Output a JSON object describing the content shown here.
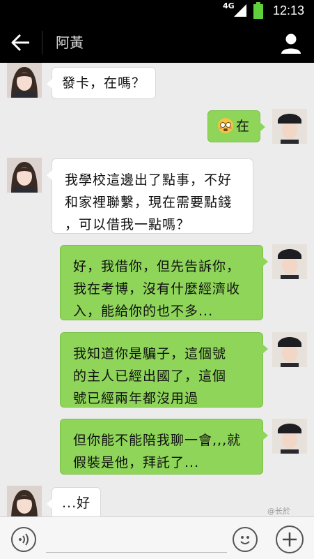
{
  "status_bar": {
    "network": "4G",
    "time": "12:13"
  },
  "title_bar": {
    "contact_name": "阿黃"
  },
  "messages": [
    {
      "sender": "contact",
      "lines": [
        "發卡，在嗎？"
      ]
    },
    {
      "sender": "me",
      "emoji": true,
      "lines": [
        "在"
      ]
    },
    {
      "sender": "contact",
      "lines": [
        "我學校這邊出了點事，不好",
        "和家裡聯繫，現在需要點錢",
        "，可以借我一點嗎？"
      ]
    },
    {
      "sender": "me",
      "lines": [
        "好，我借你，但先告訴你，",
        "我在考博，沒有什麼經濟收",
        "入，能給你的也不多..."
      ]
    },
    {
      "sender": "me",
      "lines": [
        "我知道你是騙子，這個號",
        "的主人已經出國了，這個",
        "號已經兩年都沒用過"
      ]
    },
    {
      "sender": "me",
      "lines": [
        "但你能不能陪我聊一會,,,就",
        "假裝是他，拜託了..."
      ]
    },
    {
      "sender": "contact",
      "lines": [
        "...好"
      ]
    }
  ],
  "watermark": "@长於",
  "colors": {
    "outgoing_bubble": "#8ed559",
    "incoming_bubble": "#ffffff",
    "header": "#000000"
  }
}
